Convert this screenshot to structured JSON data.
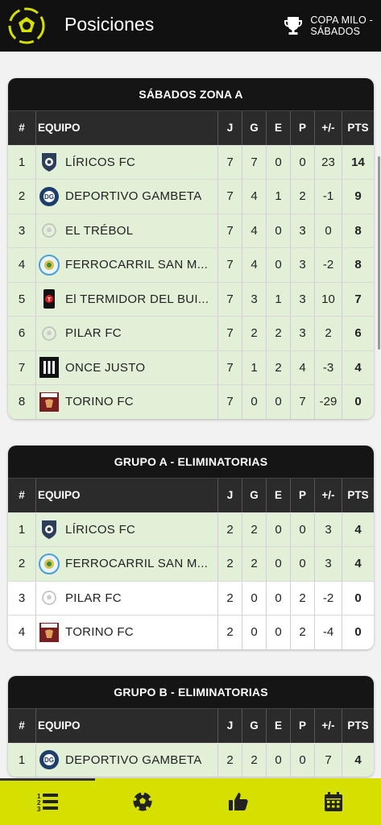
{
  "header": {
    "title": "Posiciones",
    "tournament_line1": "COPA MILO -",
    "tournament_line2": "SÁBADOS"
  },
  "colors": {
    "accent": "#d6e000",
    "header_bg": "#111111",
    "qualified_row": "#e3f0d8"
  },
  "columns": {
    "pos": "#",
    "team": "EQUIPO",
    "j": "J",
    "g": "G",
    "e": "E",
    "p": "P",
    "diff": "+/-",
    "pts": "PTS"
  },
  "tables": [
    {
      "title": "SÁBADOS ZONA A",
      "rows": [
        {
          "pos": "1",
          "team": "LÍRICOS FC",
          "j": "7",
          "g": "7",
          "e": "0",
          "p": "0",
          "diff": "23",
          "pts": "14",
          "hl": true,
          "badge": "liricos"
        },
        {
          "pos": "2",
          "team": "DEPORTIVO GAMBETA",
          "j": "7",
          "g": "4",
          "e": "1",
          "p": "2",
          "diff": "-1",
          "pts": "9",
          "hl": true,
          "badge": "gambeta"
        },
        {
          "pos": "3",
          "team": "EL TRÉBOL",
          "j": "7",
          "g": "4",
          "e": "0",
          "p": "3",
          "diff": "0",
          "pts": "8",
          "hl": true,
          "badge": "ball"
        },
        {
          "pos": "4",
          "team": "FERROCARRIL SAN M...",
          "j": "7",
          "g": "4",
          "e": "0",
          "p": "3",
          "diff": "-2",
          "pts": "8",
          "hl": true,
          "badge": "ferro"
        },
        {
          "pos": "5",
          "team": "El TERMIDOR DEL BUI...",
          "j": "7",
          "g": "3",
          "e": "1",
          "p": "3",
          "diff": "10",
          "pts": "7",
          "hl": true,
          "badge": "termidor"
        },
        {
          "pos": "6",
          "team": "PILAR FC",
          "j": "7",
          "g": "2",
          "e": "2",
          "p": "3",
          "diff": "2",
          "pts": "6",
          "hl": true,
          "badge": "ball"
        },
        {
          "pos": "7",
          "team": "ONCE JUSTO",
          "j": "7",
          "g": "1",
          "e": "2",
          "p": "4",
          "diff": "-3",
          "pts": "4",
          "hl": true,
          "badge": "once"
        },
        {
          "pos": "8",
          "team": "TORINO FC",
          "j": "7",
          "g": "0",
          "e": "0",
          "p": "7",
          "diff": "-29",
          "pts": "0",
          "hl": true,
          "badge": "torino"
        }
      ]
    },
    {
      "title": "GRUPO A - ELIMINATORIAS",
      "rows": [
        {
          "pos": "1",
          "team": "LÍRICOS FC",
          "j": "2",
          "g": "2",
          "e": "0",
          "p": "0",
          "diff": "3",
          "pts": "4",
          "hl": true,
          "badge": "liricos"
        },
        {
          "pos": "2",
          "team": "FERROCARRIL SAN M...",
          "j": "2",
          "g": "2",
          "e": "0",
          "p": "0",
          "diff": "3",
          "pts": "4",
          "hl": true,
          "badge": "ferro"
        },
        {
          "pos": "3",
          "team": "PILAR FC",
          "j": "2",
          "g": "0",
          "e": "0",
          "p": "2",
          "diff": "-2",
          "pts": "0",
          "hl": false,
          "badge": "ball"
        },
        {
          "pos": "4",
          "team": "TORINO FC",
          "j": "2",
          "g": "0",
          "e": "0",
          "p": "2",
          "diff": "-4",
          "pts": "0",
          "hl": false,
          "badge": "torino"
        }
      ]
    },
    {
      "title": "GRUPO B - ELIMINATORIAS",
      "rows": [
        {
          "pos": "1",
          "team": "DEPORTIVO GAMBETA",
          "j": "2",
          "g": "2",
          "e": "0",
          "p": "0",
          "diff": "7",
          "pts": "4",
          "hl": true,
          "badge": "gambeta"
        }
      ]
    }
  ],
  "nav": [
    {
      "icon": "standings-list-icon",
      "active": true
    },
    {
      "icon": "soccer-ball-icon",
      "active": false
    },
    {
      "icon": "thumbs-up-icon",
      "active": false
    },
    {
      "icon": "calendar-icon",
      "active": false
    }
  ]
}
